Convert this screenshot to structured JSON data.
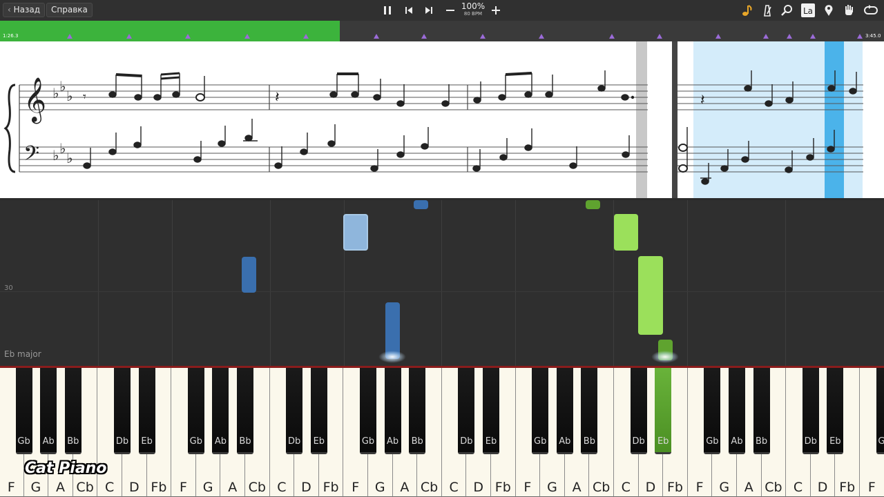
{
  "toolbar": {
    "back_label": "Назад",
    "help_label": "Справка",
    "zoom_label": "100%",
    "bpm_label": "80 BPM",
    "la_label": "La",
    "icons": [
      "pause-icon",
      "skip-back-icon",
      "skip-forward-icon",
      "minus-icon",
      "plus-icon",
      "note-icon",
      "metronome-icon",
      "search-icon",
      "la-icon",
      "pin-icon",
      "hand-icon",
      "loop-icon"
    ]
  },
  "progress": {
    "start_time": "1:26.3",
    "end_time": "3:45.0",
    "fraction": 0.384,
    "fill_color": "#3cb33c",
    "marker_color": "#9b6bd8"
  },
  "roll": {
    "row_number": "30",
    "key_signature": "Eb major",
    "left_hand_color": "#3a6fae",
    "right_hand_color": "#9be05b"
  },
  "keyboard": {
    "white_keys": [
      "F",
      "G",
      "A",
      "Cb",
      "C",
      "D",
      "Fb",
      "F",
      "G",
      "A",
      "Cb",
      "C",
      "D",
      "Fb",
      "F",
      "G",
      "A",
      "Cb",
      "C",
      "D",
      "Fb",
      "F",
      "G",
      "A",
      "Cb",
      "C",
      "D",
      "Fb",
      "F",
      "G",
      "A",
      "Cb",
      "C",
      "D",
      "Fb",
      "F"
    ],
    "black_keys": [
      "Gb",
      "Ab",
      "Bb",
      "Db",
      "Eb",
      "Gb",
      "Ab",
      "Bb",
      "Db",
      "Eb",
      "Gb",
      "Ab",
      "Bb",
      "Db",
      "Eb",
      "Gb",
      "Ab",
      "Bb",
      "Db",
      "Eb",
      "Gb",
      "Ab",
      "Bb",
      "Db",
      "Eb",
      "Gb"
    ],
    "pressed_left": "Ab",
    "pressed_right": "Eb"
  },
  "watermark": "Cat Piano"
}
